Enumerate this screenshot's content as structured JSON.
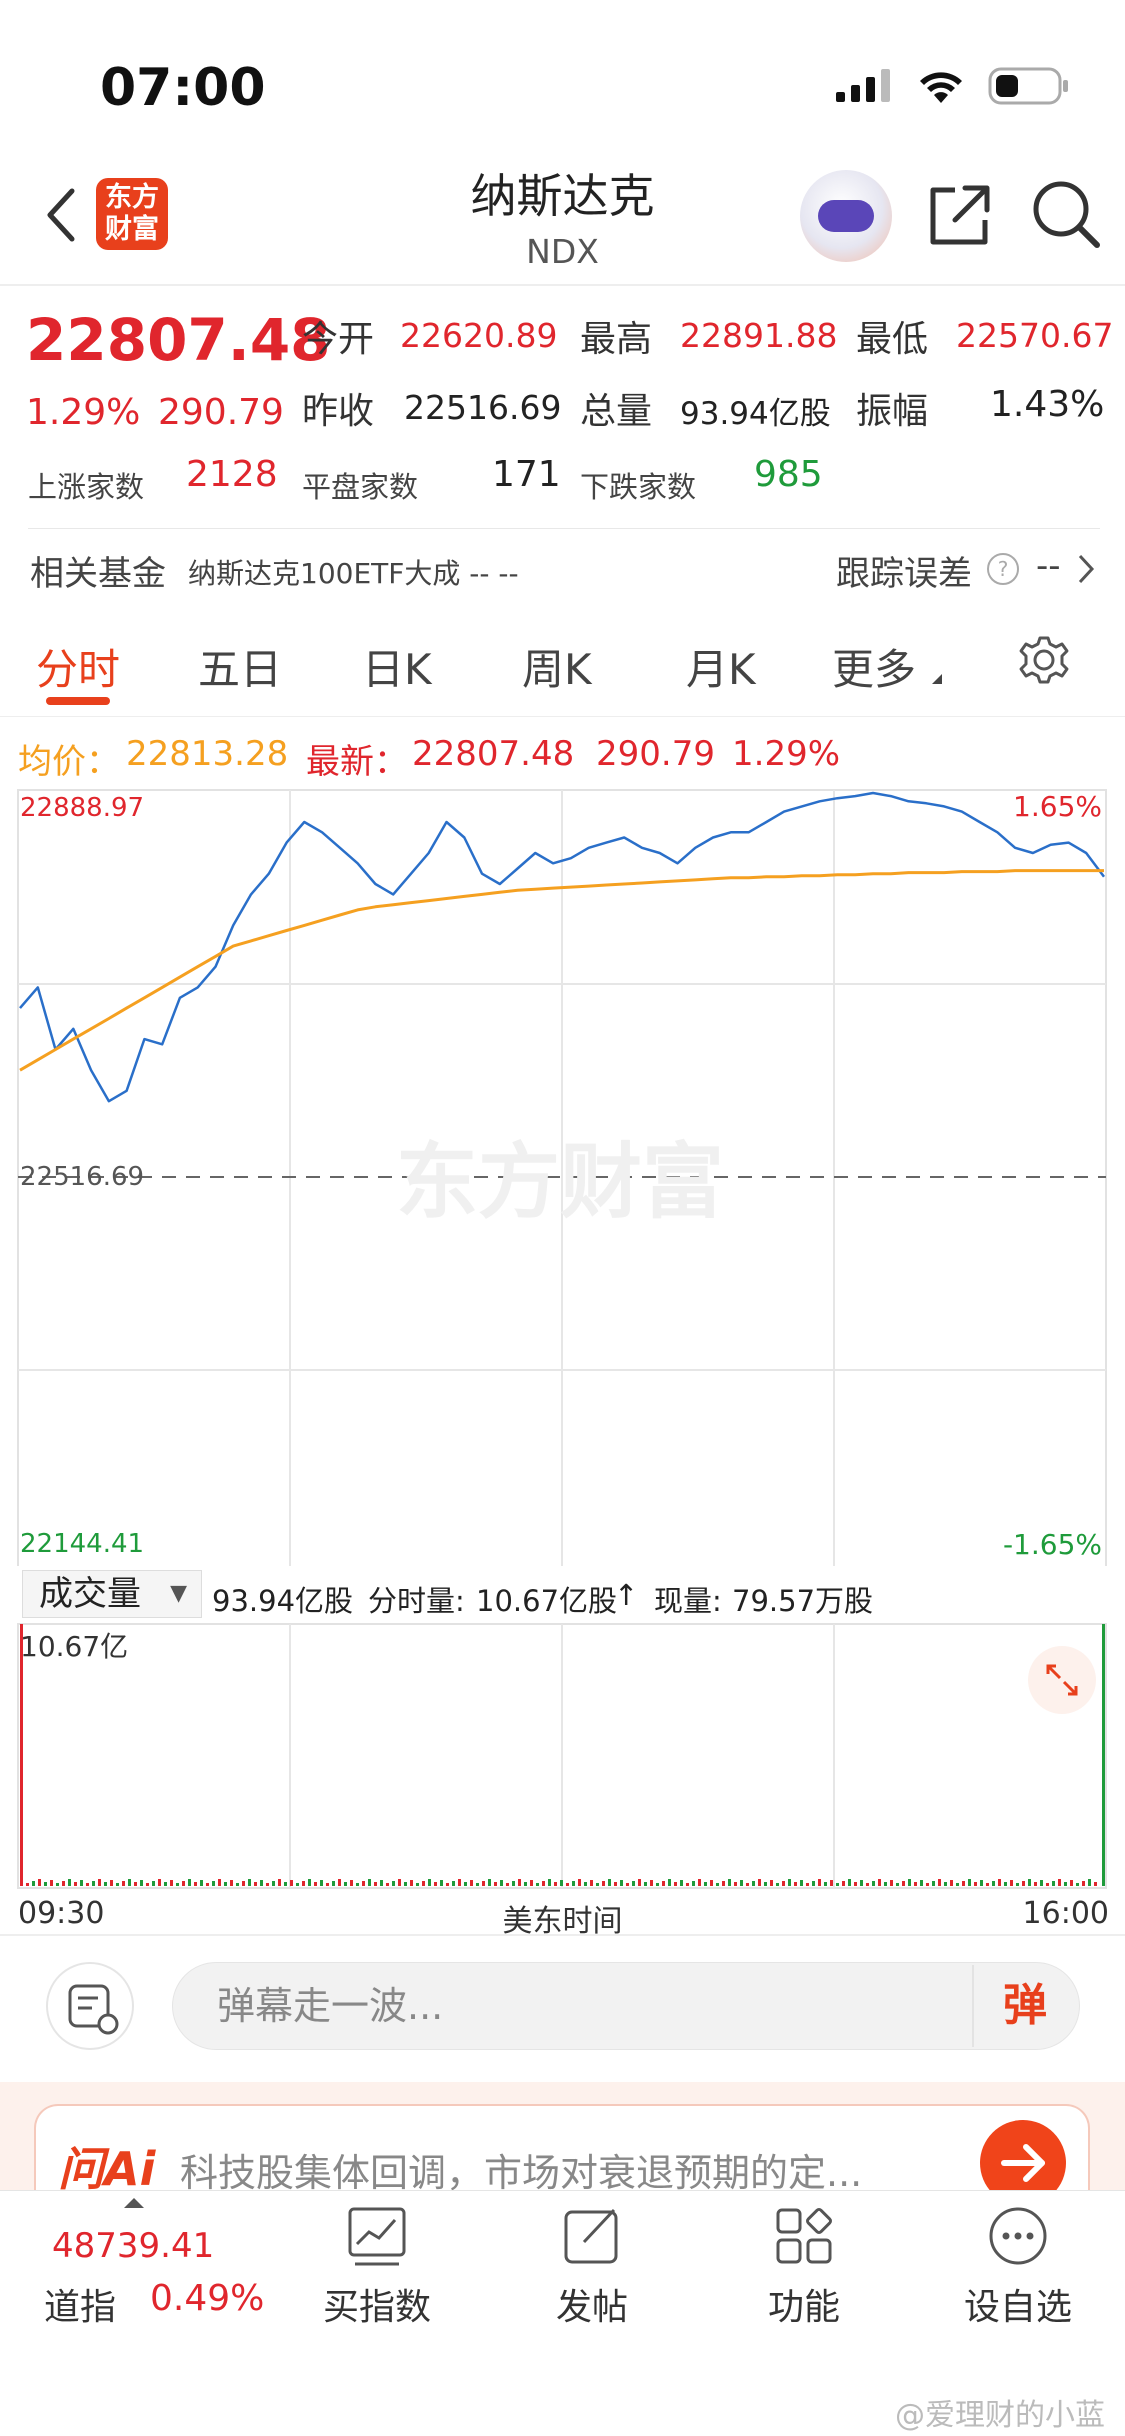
{
  "status": {
    "time": "07:00"
  },
  "header": {
    "logo_text_line1": "东方",
    "logo_text_line2": "财富",
    "title": "纳斯达克",
    "subtitle": "NDX"
  },
  "quote": {
    "price": "22807.48",
    "change_pct": "1.29%",
    "change": "290.79",
    "open_label": "今开",
    "open": "22620.89",
    "high_label": "最高",
    "high": "22891.88",
    "low_label": "最低",
    "low": "22570.67",
    "prev_close_label": "昨收",
    "prev_close": "22516.69",
    "volume_label": "总量",
    "volume": "93.94亿股",
    "amplitude_label": "振幅",
    "amplitude": "1.43%",
    "up_count_label": "上涨家数",
    "up_count": "2128",
    "flat_count_label": "平盘家数",
    "flat_count": "171",
    "down_count_label": "下跌家数",
    "down_count": "985"
  },
  "fund": {
    "label": "相关基金",
    "name": "纳斯达克100ETF大成 -- --",
    "tracking_label": "跟踪误差",
    "tracking_value": "--"
  },
  "tabs": [
    "分时",
    "五日",
    "日K",
    "周K",
    "月K",
    "更多"
  ],
  "chart_info": {
    "avg_label": "均价：",
    "avg_value": "22813.28",
    "latest_label": "最新：",
    "latest_value": "22807.48",
    "latest_change": "290.79",
    "latest_pct": "1.29%"
  },
  "chart_data": {
    "type": "line",
    "y_top_label": "22888.97",
    "y_mid_label": "22516.69",
    "y_bottom_label": "22144.41",
    "pct_top_label": "1.65%",
    "pct_bottom_label": "-1.65%",
    "ylim": [
      22144.41,
      22888.97
    ],
    "baseline": 22516.69,
    "x_start_label": "09:30",
    "x_mid_label": "美东时间",
    "x_end_label": "16:00",
    "watermark": "东方财富",
    "series": [
      {
        "name": "最新",
        "color": "#2a6fc9",
        "values": [
          22680,
          22700,
          22640,
          22660,
          22620,
          22590,
          22600,
          22650,
          22645,
          22690,
          22700,
          22720,
          22760,
          22790,
          22810,
          22840,
          22860,
          22850,
          22835,
          22820,
          22800,
          22790,
          22810,
          22830,
          22860,
          22845,
          22810,
          22800,
          22815,
          22830,
          22820,
          22825,
          22835,
          22840,
          22845,
          22835,
          22830,
          22820,
          22835,
          22845,
          22850,
          22850,
          22860,
          22870,
          22875,
          22880,
          22883,
          22885,
          22888,
          22885,
          22880,
          22878,
          22875,
          22870,
          22860,
          22850,
          22835,
          22830,
          22838,
          22840,
          22830,
          22807
        ]
      },
      {
        "name": "均价",
        "color": "#f5a020",
        "values": [
          22620,
          22630,
          22640,
          22650,
          22660,
          22670,
          22680,
          22690,
          22700,
          22710,
          22720,
          22730,
          22740,
          22745,
          22750,
          22755,
          22760,
          22765,
          22770,
          22775,
          22778,
          22780,
          22782,
          22784,
          22786,
          22788,
          22790,
          22792,
          22794,
          22795,
          22796,
          22797,
          22798,
          22799,
          22800,
          22801,
          22802,
          22803,
          22804,
          22805,
          22806,
          22806,
          22807,
          22807,
          22808,
          22808,
          22809,
          22809,
          22810,
          22810,
          22811,
          22811,
          22811,
          22812,
          22812,
          22812,
          22813,
          22813,
          22813,
          22813,
          22813,
          22813
        ]
      }
    ]
  },
  "volume": {
    "select_label": "成交量",
    "total": "93.94亿股",
    "tick_label": "分时量:",
    "tick_value": "10.67亿股",
    "now_label": "现量:",
    "now_value": "79.57万股",
    "max_label": "10.67亿"
  },
  "comment": {
    "placeholder": "弹幕走一波...",
    "button": "弹"
  },
  "ai_banner": {
    "logo": "问Ai",
    "text": "科技股集体回调，市场对衰退预期的定..."
  },
  "bottom_nav": {
    "index_value": "48739.41",
    "index_name": "道指",
    "index_pct": "0.49%",
    "items": [
      "买指数",
      "发帖",
      "功能",
      "设自选"
    ]
  },
  "watermark_user": "@爱理财的小蓝"
}
